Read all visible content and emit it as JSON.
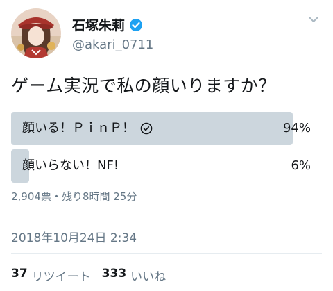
{
  "user": {
    "display_name": "石塚朱莉",
    "handle": "@akari_0711",
    "verified": true
  },
  "icons": {
    "verified": "verified-badge-icon",
    "more": "chevron-down-icon",
    "voted": "check-circle-icon"
  },
  "tweet": {
    "text": "ゲーム実況で私の顔いりますか？"
  },
  "poll": {
    "options": [
      {
        "label": "顔いる！ＰｉｎＰ！",
        "percent": "94%",
        "fraction": 0.94,
        "voted": true
      },
      {
        "label": "顔いらない！NF!",
        "percent": "6%",
        "fraction": 0.06,
        "voted": false
      }
    ],
    "meta": "2,904票・残り8時間 25分"
  },
  "timestamp": "2018年10月24日 2:34",
  "stats": {
    "retweets_count": "37",
    "retweets_label": "リツイート",
    "likes_count": "333",
    "likes_label": "いいね"
  },
  "colors": {
    "bar": "#ccd6dd",
    "text": "#14171a",
    "secondary": "#657786",
    "verified": "#1da1f2",
    "divider": "#e6ecf0"
  }
}
